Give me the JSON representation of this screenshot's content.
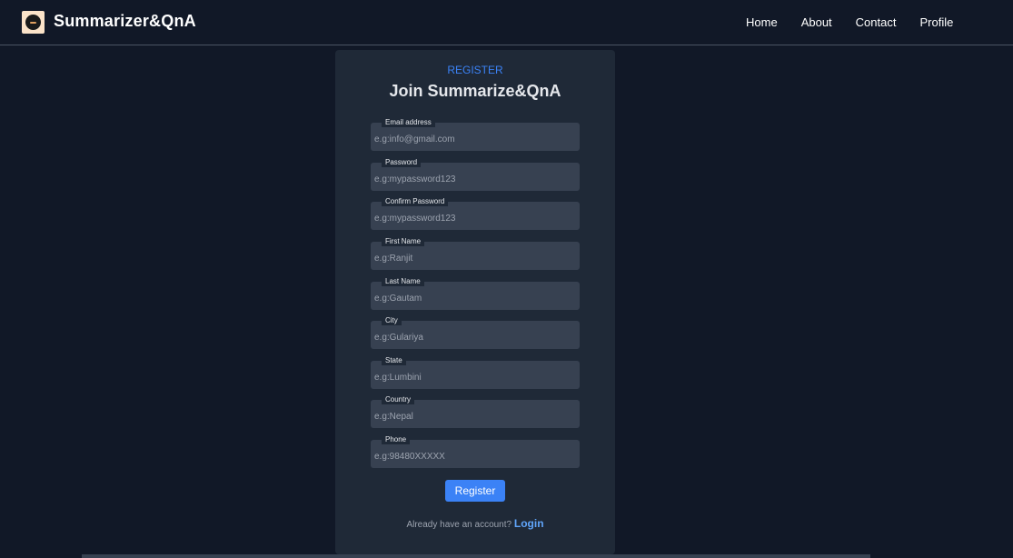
{
  "navbar": {
    "brand": "Summarizer&QnA",
    "links": [
      "Home",
      "About",
      "Contact",
      "Profile"
    ]
  },
  "form": {
    "subtitle": "REGISTER",
    "title": "Join Summarize&QnA",
    "fields": [
      {
        "label": "Email address",
        "placeholder": "e.g:info@gmail.com",
        "value": ""
      },
      {
        "label": "Password",
        "placeholder": "e.g:mypassword123",
        "value": ""
      },
      {
        "label": "Confirm Password",
        "placeholder": "e.g:mypassword123",
        "value": ""
      },
      {
        "label": "First Name",
        "placeholder": "e.g:Ranjit",
        "value": ""
      },
      {
        "label": "Last Name",
        "placeholder": "e.g:Gautam",
        "value": ""
      },
      {
        "label": "City",
        "placeholder": "e.g:Gulariya",
        "value": ""
      },
      {
        "label": "State",
        "placeholder": "e.g:Lumbini",
        "value": ""
      },
      {
        "label": "Country",
        "placeholder": "e.g:Nepal",
        "value": ""
      },
      {
        "label": "Phone",
        "placeholder": "e.g:98480XXXXX",
        "value": ""
      }
    ],
    "register_label": "Register",
    "account_prompt": "Already have an account?",
    "login_label": "Login"
  },
  "colors": {
    "background": "#111827",
    "card": "#1f2937",
    "input": "#374151",
    "accent": "#3b82f6"
  }
}
